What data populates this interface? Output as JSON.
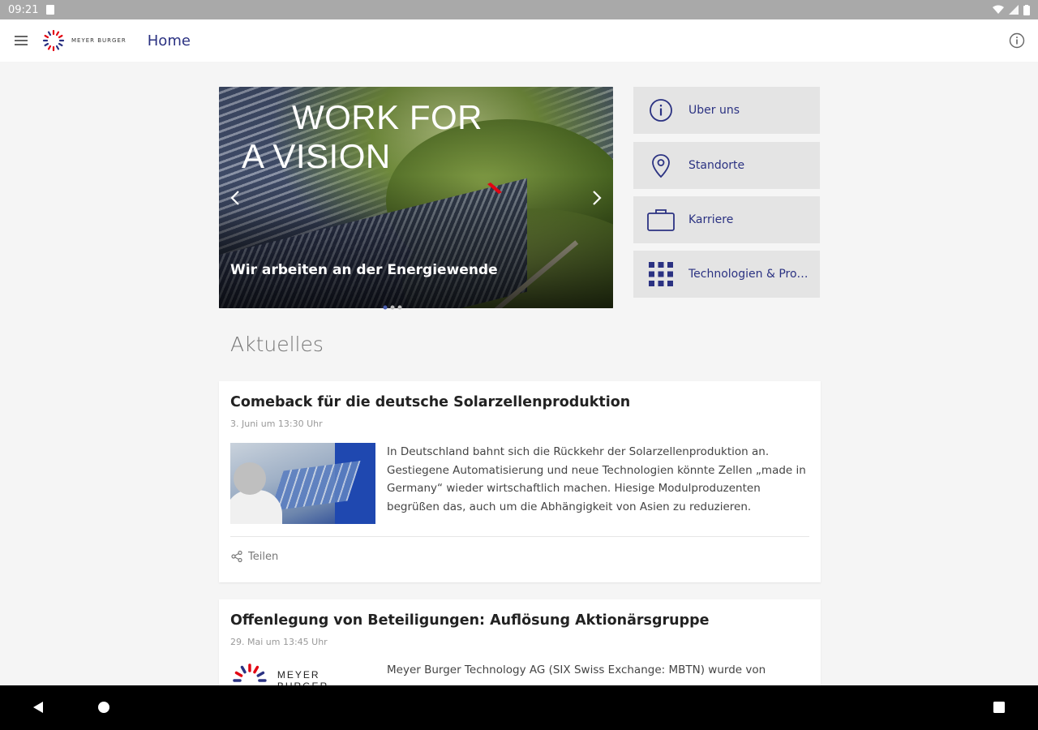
{
  "status_bar": {
    "time": "09:21"
  },
  "app_bar": {
    "logo_text": "MEYER BURGER",
    "title": "Home"
  },
  "hero": {
    "headline_line1": "WORK FOR",
    "headline_line2": "A VISION",
    "caption": "Wir arbeiten an der Energiewende"
  },
  "tiles": [
    {
      "label": "Über uns",
      "icon": "info-circle-icon"
    },
    {
      "label": "Standorte",
      "icon": "location-pin-icon"
    },
    {
      "label": "Karriere",
      "icon": "briefcase-icon"
    },
    {
      "label": "Technologien & Produkte",
      "icon": "grid-icon"
    }
  ],
  "news": {
    "section_title": "Aktuelles",
    "items": [
      {
        "title": "Comeback für die deutsche Solarzellenproduktion",
        "date": "3. Juni um 13:30 Uhr",
        "text": "In Deutschland bahnt sich die Rückkehr der Solarzellenproduktion an. Gestiegene Automatisierung und neue Technologien könnte Zellen „made in Germany“ wieder wirtschaftlich machen. Hiesige Modulproduzenten begrüßen das, auch um die Abhängigkeit von Asien zu reduzieren.",
        "share_label": "Teilen"
      },
      {
        "title": "Offenlegung von Beteiligungen: Auflösung Aktionärsgruppe",
        "date": "29. Mai um 13:45 Uhr",
        "thumb_logo_text": "MEYER BURGER",
        "text": "Meyer Burger Technology AG (SIX Swiss Exchange: MBTN) wurde von"
      }
    ]
  },
  "colors": {
    "brand_blue": "#2b3282",
    "brand_red": "#e30613",
    "tile_bg": "#e4e4e4"
  }
}
